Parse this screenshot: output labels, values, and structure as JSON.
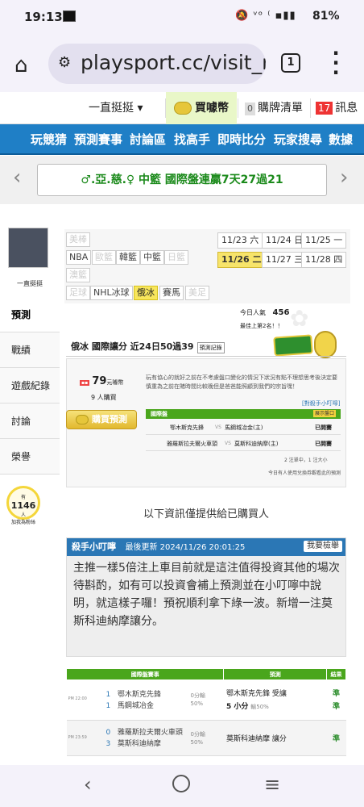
{
  "status": {
    "time": "19:13",
    "signal": "🔕 ᵛᵒ ⁽ ▪▮▮",
    "battery": "81%"
  },
  "browser": {
    "url": "playsport.cc/visit_m",
    "tabs": "1"
  },
  "topnav": {
    "item1": "一直挺挺 ▾",
    "item2": "買噱幣",
    "item3_badge": "0",
    "item3": "購牌清單",
    "item4_badge": "17",
    "item4": "訊息"
  },
  "bluenav": [
    "玩競猜",
    "預測賽事",
    "討論區",
    "找高手",
    "即時比分",
    "玩家搜尋",
    "數據"
  ],
  "banner": {
    "text": "♂.亞.慈.♀ 中籃 國際盤連贏7天27過21"
  },
  "sidebar": {
    "username": "一直挺挺",
    "menu": [
      "預測",
      "戰績",
      "遊戲紀錄",
      "討論",
      "榮譽"
    ],
    "bulb_count": "1146",
    "bulb_unit": "人",
    "bulb_prefix": "有",
    "bulb_text": "加我為粉絲"
  },
  "sports": {
    "row1": [
      "美棒"
    ],
    "row2": [
      "NBA",
      "歐籃",
      "韓籃",
      "中籃",
      "日籃"
    ],
    "row3": [
      "澳籃"
    ],
    "row4": [
      "足球",
      "NHL冰球",
      "俄冰",
      "賽馬",
      "美足"
    ]
  },
  "dates": [
    "11/23 六",
    "11/24 日",
    "11/25 一",
    "11/26 二",
    "11/27 三",
    "11/28 四"
  ],
  "popularity": {
    "label": "今日人氣",
    "value": "456",
    "rank": "最佳上第2名！！"
  },
  "game": {
    "title": "俄冰 國際讓分 近24日50過39",
    "btn": "預測記錄",
    "price": "79",
    "price_unit": "元噱幣",
    "buyers": "9 人購買",
    "buy_btn": "購買預測",
    "notice": "玩有協心的就好之前在不考慮盤口變化的情況下狀況有點不理想思考後決定要慎重為之前在賭時間比較晚但是爸爸能照顧到我們的宗旨嘿！",
    "link": "[對殺手小叮嚀]",
    "table_head1": "國際盤",
    "table_head2": "展示盤口",
    "rows": [
      {
        "away": "鄂木斯克先鋒",
        "home": "馬鋼城冶金(主)",
        "status": "已開賽"
      },
      {
        "away": "雅羅斯拉夫爾火車頭",
        "home": "莫斯科迪納摩(主)",
        "status": "已開賽"
      }
    ],
    "pages": "2 注單中，1 注大小",
    "footer": "今日有人使用兌換券觀看此的預測"
  },
  "only_buyers": "以下資訊僅提供給已購買人",
  "killer": {
    "title": "殺手小叮嚀",
    "updated": "最後更新 2024/11/26 20:01:25",
    "report": "我要檢舉",
    "text": "主推一樣5倍注上車目前就是這注值得投資其他的場次待斟酌，如有可以投資會補上預測並在小叮嚀中說明，就這樣子囉！預祝順利拿下綠一波。新增一注莫斯科迪納摩讓分。"
  },
  "predictions": {
    "headers": [
      "國際盤賽事",
      "預測",
      "結果"
    ],
    "rows": [
      {
        "time": "PM 22:00",
        "n1": "1",
        "t1": "鄂木斯克先鋒",
        "n2": "1",
        "t2": "馬鋼城冶金",
        "odds": "0分輸\n50%",
        "pick": "鄂木斯克先鋒 受讓",
        "pick2": "5 小分",
        "pct": "輸50%",
        "res1": "準",
        "res2": "準"
      },
      {
        "time": "PM 23:59",
        "n1": "0",
        "t1": "雅羅斯拉夫爾火車頭",
        "n2": "3",
        "t2": "莫斯科迪納摩",
        "odds": "0分輸\n50%",
        "pick": "莫斯科迪納摩 讓分",
        "pick2": "",
        "pct": "",
        "res1": "準",
        "res2": ""
      }
    ]
  }
}
